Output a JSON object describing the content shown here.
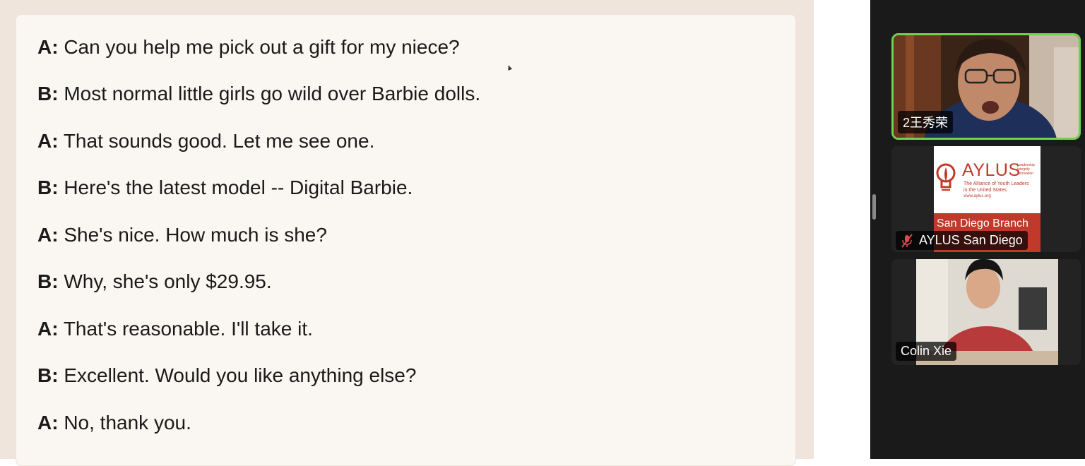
{
  "dialogue": [
    {
      "speaker": "A:",
      "text": "Can you help me pick out a gift for my niece?"
    },
    {
      "speaker": "B:",
      "text": "Most normal little girls go wild over Barbie dolls."
    },
    {
      "speaker": "A:",
      "text": "That sounds good. Let me see one."
    },
    {
      "speaker": "B:",
      "text": "Here's the latest model -- Digital Barbie."
    },
    {
      "speaker": "A:",
      "text": "She's nice. How much is she?"
    },
    {
      "speaker": "B:",
      "text": "Why, she's only $29.95."
    },
    {
      "speaker": "A:",
      "text": "That's reasonable. I'll take it."
    },
    {
      "speaker": "B:",
      "text": "Excellent. Would you like anything else?"
    },
    {
      "speaker": "A:",
      "text": "No, thank you."
    }
  ],
  "participants": [
    {
      "name": "2王秀荣",
      "active": true,
      "muted": false
    },
    {
      "name": "AYLUS San Diego",
      "active": false,
      "muted": true,
      "logo": {
        "title": "AYLUS",
        "tagline_words": [
          "Leadership",
          "Integrity",
          "Innovation"
        ],
        "org_line1": "The Alliance of Youth Leaders",
        "org_line2": "in the United States",
        "url": "www.aylus.org",
        "branch": "San Diego Branch"
      }
    },
    {
      "name": "Colin Xie",
      "active": false,
      "muted": false
    }
  ],
  "colors": {
    "active_speaker_border": "#6fd14f",
    "panel_bg": "#1a1a1a",
    "aylus_red": "#c0392b"
  },
  "icons": [
    "mic-muted-icon",
    "cursor-icon"
  ]
}
